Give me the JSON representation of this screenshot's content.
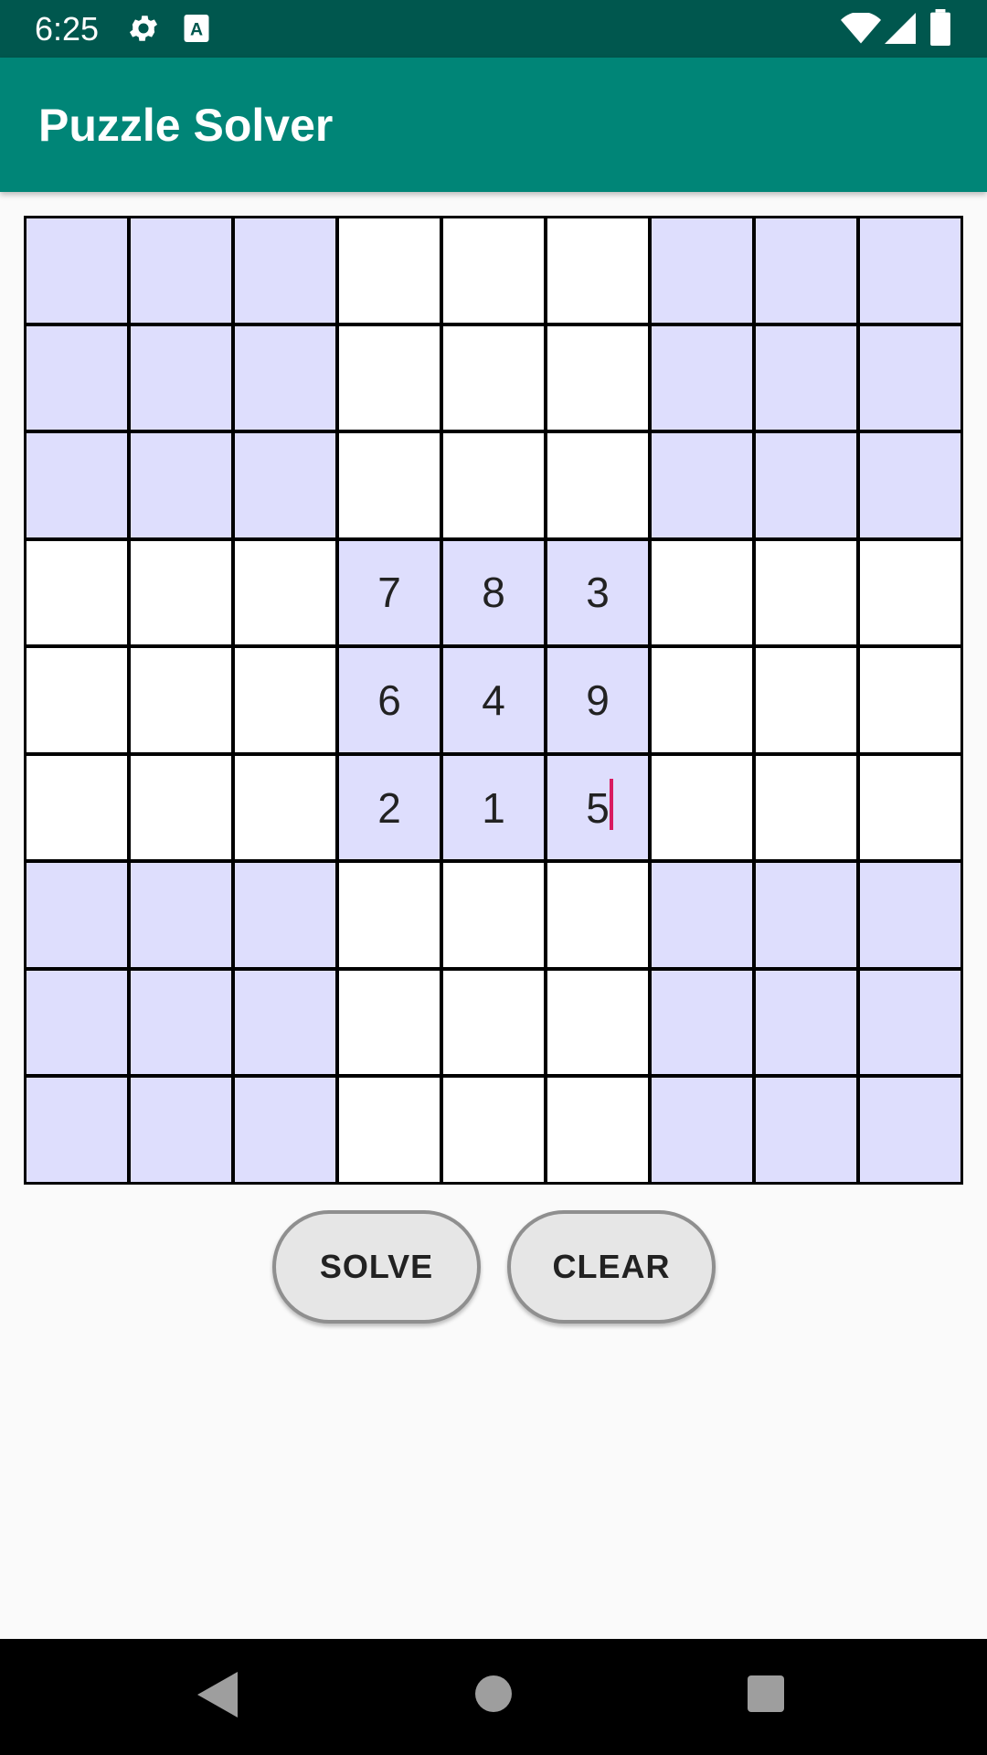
{
  "status_bar": {
    "time": "6:25",
    "icons_left": [
      "gear-icon",
      "font-a-icon"
    ],
    "icons_right": [
      "wifi-icon",
      "signal-icon",
      "battery-icon"
    ]
  },
  "app_bar": {
    "title": "Puzzle Solver"
  },
  "colors": {
    "status_bar": "#00574e",
    "app_bar": "#008577",
    "shaded_cell": "#dedefd",
    "cursor": "#d81b60"
  },
  "grid": {
    "rows": [
      [
        "",
        "",
        "",
        "",
        "",
        "",
        "",
        "",
        ""
      ],
      [
        "",
        "",
        "",
        "",
        "",
        "",
        "",
        "",
        ""
      ],
      [
        "",
        "",
        "",
        "",
        "",
        "",
        "",
        "",
        ""
      ],
      [
        "",
        "",
        "",
        "7",
        "8",
        "3",
        "",
        "",
        ""
      ],
      [
        "",
        "",
        "",
        "6",
        "4",
        "9",
        "",
        "",
        ""
      ],
      [
        "",
        "",
        "",
        "2",
        "1",
        "5",
        "",
        "",
        ""
      ],
      [
        "",
        "",
        "",
        "",
        "",
        "",
        "",
        "",
        ""
      ],
      [
        "",
        "",
        "",
        "",
        "",
        "",
        "",
        "",
        ""
      ],
      [
        "",
        "",
        "",
        "",
        "",
        "",
        "",
        "",
        ""
      ]
    ],
    "focused_cell": {
      "row": 5,
      "col": 5
    }
  },
  "buttons": {
    "solve": "SOLVE",
    "clear": "CLEAR"
  },
  "nav_bar": {
    "icons": [
      "back-icon",
      "home-icon",
      "recents-icon"
    ]
  }
}
